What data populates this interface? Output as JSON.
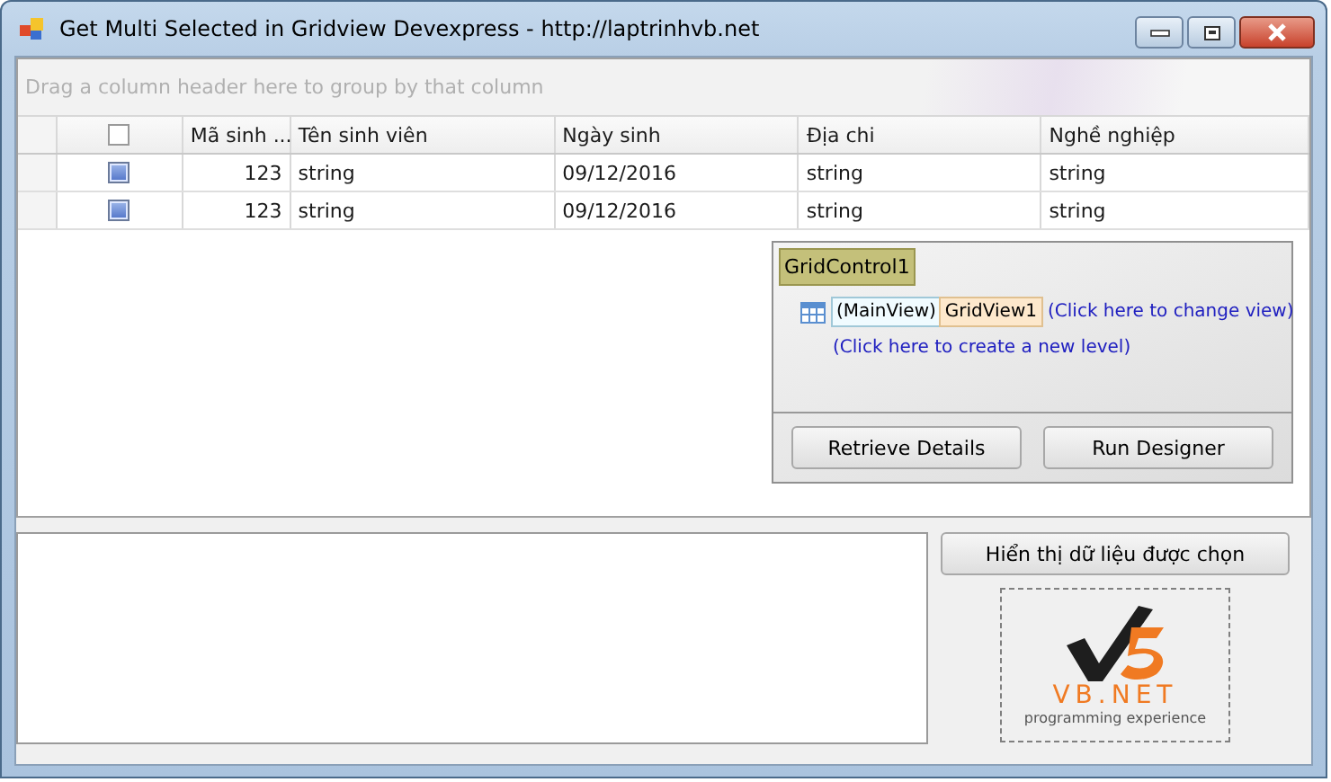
{
  "window": {
    "title": "Get Multi Selected in Gridview Devexpress - http://laptrinhvb.net"
  },
  "grid": {
    "group_panel_hint": "Drag a column header here to group by that column",
    "select_all_checked": false,
    "columns": [
      "Mã sinh ...",
      "Tên sinh viên",
      "Ngày sinh",
      "Địa chi",
      "Nghề nghiệp"
    ],
    "rows": [
      {
        "selected": true,
        "cells": [
          "123",
          "string",
          "09/12/2016",
          "string",
          "string"
        ]
      },
      {
        "selected": true,
        "cells": [
          "123",
          "string",
          "09/12/2016",
          "string",
          "string"
        ]
      }
    ]
  },
  "designer": {
    "control_name": "GridControl1",
    "main_view": "(MainView)",
    "view_name": "GridView1",
    "change_view_link": "(Click here to change view)",
    "new_level_link": "(Click here to create a new level)",
    "buttons": [
      "Retrieve Details",
      "Run Designer"
    ]
  },
  "show_button": "Hiển thị dữ liệu được chọn",
  "logo": {
    "brand": "VB.NET",
    "tagline": "programming experience"
  }
}
